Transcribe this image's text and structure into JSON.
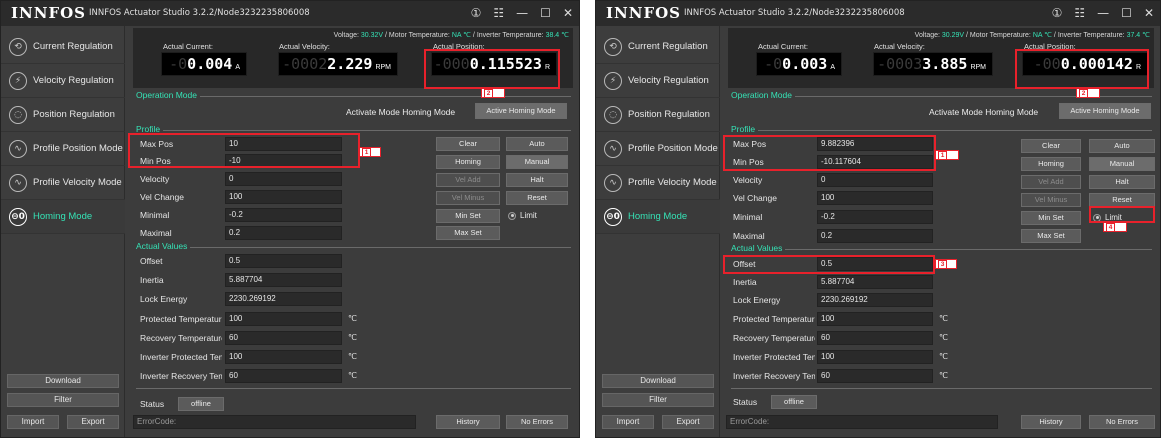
{
  "panels": [
    {
      "app": {
        "logo": "INNFOS",
        "title": "INNFOS Actuator Studio 3.2.2/Node3232235806008",
        "controls": [
          "①",
          "☷",
          "—",
          "☐",
          "✕"
        ]
      },
      "sidebar": {
        "items": [
          {
            "label": "Current Regulation",
            "icon": "current-regulation-icon",
            "glyph": "⟲"
          },
          {
            "label": "Velocity Regulation",
            "icon": "velocity-regulation-icon",
            "glyph": "⚡"
          },
          {
            "label": "Position Regulation",
            "icon": "position-regulation-icon",
            "glyph": "◌"
          },
          {
            "label": "Profile Position Mode",
            "icon": "profile-position-icon",
            "glyph": "∿"
          },
          {
            "label": "Profile Velocity Mode",
            "icon": "profile-velocity-icon",
            "glyph": "∿"
          },
          {
            "label": "Homing Mode",
            "icon": "homing-icon",
            "glyph": "⊖0",
            "active": true
          }
        ],
        "buttons": {
          "download": "Download",
          "filter": "Filter",
          "import": "Import",
          "export": "Export"
        }
      },
      "readouts": {
        "voltage_prefix": "Voltage: ",
        "voltage": "30.32V",
        "motor_temp_prefix": " / Motor Temperature: ",
        "motor_temp": "NA ℃",
        "inverter_temp_prefix": " / Inverter Temperature: ",
        "inverter_temp": "38.4 ℃",
        "current": {
          "label": "Actual Current:",
          "ghost": "-0",
          "value": "0.004",
          "unit": "A"
        },
        "velocity": {
          "label": "Actual Velocity:",
          "ghost": "-0002",
          "value": "2.229",
          "unit": "RPM"
        },
        "position": {
          "label": "Actual Position:",
          "ghost": "-000",
          "value": "0.115523",
          "unit": "R"
        }
      },
      "operation_mode": {
        "title": "Operation Mode",
        "text": "Activate Mode Homing Mode",
        "button": "Active Homing Mode"
      },
      "profile": {
        "title": "Profile",
        "fields": [
          {
            "label": "Max Pos",
            "value": "10"
          },
          {
            "label": "Min Pos",
            "value": "-10"
          },
          {
            "label": "Velocity",
            "value": "0"
          },
          {
            "label": "Vel Change",
            "value": "100"
          },
          {
            "label": "Minimal",
            "value": "-0.2"
          },
          {
            "label": "Maximal",
            "value": "0.2"
          }
        ],
        "buttons": {
          "clear": "Clear",
          "auto": "Auto",
          "homing": "Homing",
          "manual": "Manual",
          "vel_add": "Vel Add",
          "halt": "Halt",
          "vel_minus": "Vel Minus",
          "reset": "Reset",
          "min_set": "Min Set",
          "max_set": "Max Set"
        },
        "limit_label": "Limit"
      },
      "actual_values": {
        "title": "Actual Values",
        "fields": [
          {
            "label": "Offset",
            "value": "0.5",
            "unit": ""
          },
          {
            "label": "Inertia",
            "value": "5.887704",
            "unit": ""
          },
          {
            "label": "Lock Energy",
            "value": "2230.269192",
            "unit": ""
          },
          {
            "label": "Protected Temperature",
            "value": "100",
            "unit": "℃"
          },
          {
            "label": "Recovery Temperature",
            "value": "60",
            "unit": "℃"
          },
          {
            "label": "Inverter Protected Temperature",
            "value": "100",
            "unit": "℃"
          },
          {
            "label": "Inverter Recovery Temperature",
            "value": "60",
            "unit": "℃"
          }
        ]
      },
      "status": {
        "label": "Status",
        "value": "offline"
      },
      "footer": {
        "error_placeholder": "ErrorCode:",
        "history": "History",
        "no_errors": "No Errors"
      },
      "annotations": [
        "1",
        "2"
      ]
    },
    {
      "app": {
        "logo": "INNFOS",
        "title": "INNFOS Actuator Studio 3.2.2/Node3232235806008",
        "controls": [
          "①",
          "☷",
          "—",
          "☐",
          "✕"
        ]
      },
      "sidebar": {
        "items": [
          {
            "label": "Current Regulation",
            "icon": "current-regulation-icon",
            "glyph": "⟲"
          },
          {
            "label": "Velocity Regulation",
            "icon": "velocity-regulation-icon",
            "glyph": "⚡"
          },
          {
            "label": "Position Regulation",
            "icon": "position-regulation-icon",
            "glyph": "◌"
          },
          {
            "label": "Profile Position Mode",
            "icon": "profile-position-icon",
            "glyph": "∿"
          },
          {
            "label": "Profile Velocity Mode",
            "icon": "profile-velocity-icon",
            "glyph": "∿"
          },
          {
            "label": "Homing Mode",
            "icon": "homing-icon",
            "glyph": "⊖0",
            "active": true
          }
        ],
        "buttons": {
          "download": "Download",
          "filter": "Filter",
          "import": "Import",
          "export": "Export"
        }
      },
      "readouts": {
        "voltage_prefix": "Voltage: ",
        "voltage": "30.29V",
        "motor_temp_prefix": " / Motor Temperature: ",
        "motor_temp": "NA ℃",
        "inverter_temp_prefix": " / Inverter Temperature: ",
        "inverter_temp": "37.4 ℃",
        "current": {
          "label": "Actual Current:",
          "ghost": "-0",
          "value": "0.003",
          "unit": "A"
        },
        "velocity": {
          "label": "Actual Velocity:",
          "ghost": "-0003",
          "value": "3.885",
          "unit": "RPM"
        },
        "position": {
          "label": "Actual Position:",
          "ghost": "-00",
          "value": "0.000142",
          "unit": "R"
        }
      },
      "operation_mode": {
        "title": "Operation Mode",
        "text": "Activate Mode Homing Mode",
        "button": "Active Homing Mode"
      },
      "profile": {
        "title": "Profile",
        "fields": [
          {
            "label": "Max Pos",
            "value": "9.882396"
          },
          {
            "label": "Min Pos",
            "value": "-10.117604"
          },
          {
            "label": "Velocity",
            "value": "0"
          },
          {
            "label": "Vel Change",
            "value": "100"
          },
          {
            "label": "Minimal",
            "value": "-0.2"
          },
          {
            "label": "Maximal",
            "value": "0.2"
          }
        ],
        "buttons": {
          "clear": "Clear",
          "auto": "Auto",
          "homing": "Homing",
          "manual": "Manual",
          "vel_add": "Vel Add",
          "halt": "Halt",
          "vel_minus": "Vel Minus",
          "reset": "Reset",
          "min_set": "Min Set",
          "max_set": "Max Set"
        },
        "limit_label": "Limit"
      },
      "actual_values": {
        "title": "Actual Values",
        "fields": [
          {
            "label": "Offset",
            "value": "0.5",
            "unit": ""
          },
          {
            "label": "Inertia",
            "value": "5.887704",
            "unit": ""
          },
          {
            "label": "Lock Energy",
            "value": "2230.269192",
            "unit": ""
          },
          {
            "label": "Protected Temperature",
            "value": "100",
            "unit": "℃"
          },
          {
            "label": "Recovery Temperature",
            "value": "60",
            "unit": "℃"
          },
          {
            "label": "Inverter Protected Temperature",
            "value": "100",
            "unit": "℃"
          },
          {
            "label": "Inverter Recovery Temperature",
            "value": "60",
            "unit": "℃"
          }
        ]
      },
      "status": {
        "label": "Status",
        "value": "offline"
      },
      "footer": {
        "error_placeholder": "ErrorCode:",
        "history": "History",
        "no_errors": "No Errors"
      },
      "annotations": [
        "1",
        "2",
        "3",
        "4"
      ]
    }
  ],
  "colors": {
    "accent": "#35e3b6",
    "highlight": "#e8212b",
    "window_bg": "#3c3c3c",
    "lcd_bg": "#000000"
  }
}
